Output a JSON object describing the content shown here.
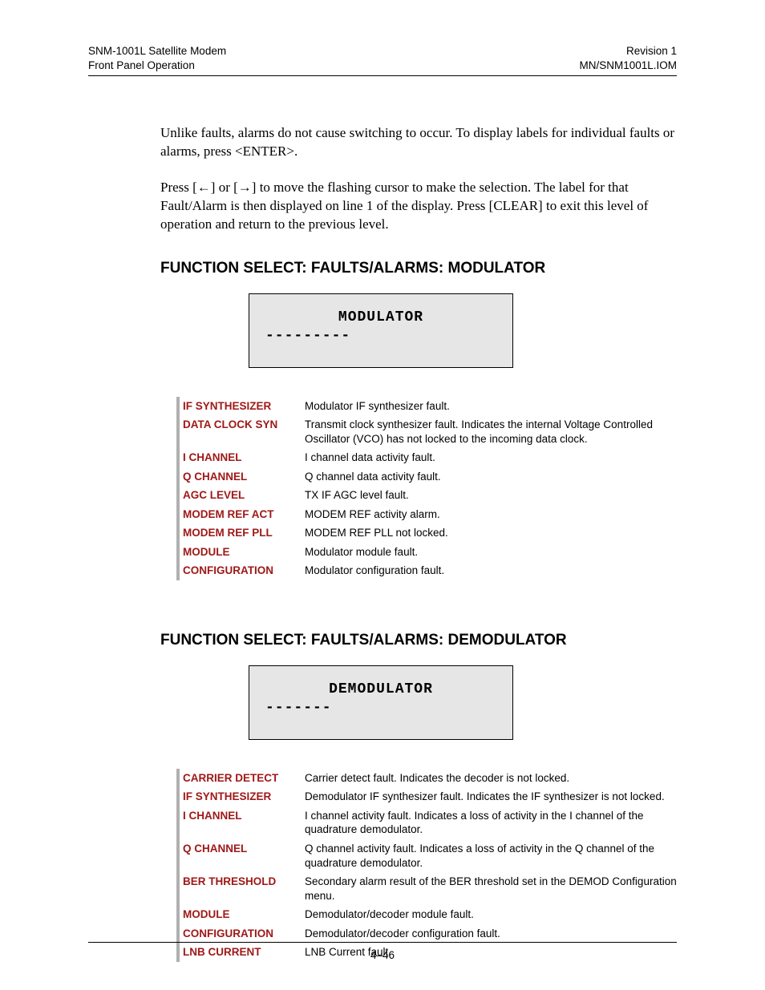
{
  "header": {
    "left1": "SNM-1001L Satellite Modem",
    "left2": "Front Panel Operation",
    "right1": "Revision 1",
    "right2": "MN/SNM1001L.IOM"
  },
  "intro": {
    "p1": "Unlike faults, alarms do not cause switching to occur. To display labels for individual faults or alarms, press <ENTER>.",
    "p2": "Press [←] or [→] to move the flashing cursor to make the selection. The label for that Fault/Alarm is then displayed on line 1 of the display. Press [CLEAR] to exit this level of operation and return to the previous level."
  },
  "sections": [
    {
      "heading": "FUNCTION SELECT: FAULTS/ALARMS: MODULATOR",
      "display": {
        "line1": "MODULATOR",
        "line2": "---------"
      },
      "rows": [
        {
          "name": "IF SYNTHESIZER",
          "desc": "Modulator IF synthesizer fault."
        },
        {
          "name": "DATA CLOCK SYN",
          "desc": "Transmit clock synthesizer fault. Indicates the internal Voltage Controlled Oscillator (VCO) has not locked to the incoming data clock."
        },
        {
          "name": "I CHANNEL",
          "desc": "I channel data activity fault."
        },
        {
          "name": "Q CHANNEL",
          "desc": "Q channel data activity fault."
        },
        {
          "name": "AGC LEVEL",
          "desc": "TX IF AGC level fault."
        },
        {
          "name": "MODEM REF ACT",
          "desc": "MODEM REF activity alarm."
        },
        {
          "name": "MODEM REF PLL",
          "desc": "MODEM REF PLL not locked."
        },
        {
          "name": "MODULE",
          "desc": "Modulator module fault."
        },
        {
          "name": "CONFIGURATION",
          "desc": "Modulator configuration fault."
        }
      ]
    },
    {
      "heading": "FUNCTION SELECT: FAULTS/ALARMS: DEMODULATOR",
      "display": {
        "line1": "DEMODULATOR",
        "line2": "-------"
      },
      "rows": [
        {
          "name": "CARRIER DETECT",
          "desc": "Carrier detect fault. Indicates the decoder is not locked."
        },
        {
          "name": "IF SYNTHESIZER",
          "desc": "Demodulator IF synthesizer fault. Indicates the IF synthesizer is not locked."
        },
        {
          "name": "I CHANNEL",
          "desc": "I channel activity fault. Indicates a loss of activity in the I channel of the quadrature demodulator."
        },
        {
          "name": "Q CHANNEL",
          "desc": "Q channel activity fault. Indicates a loss of activity in the Q channel of the quadrature demodulator."
        },
        {
          "name": "BER THRESHOLD",
          "desc": "Secondary alarm result of the BER threshold set in the DEMOD Configuration menu."
        },
        {
          "name": "MODULE",
          "desc": "Demodulator/decoder module fault."
        },
        {
          "name": "CONFIGURATION",
          "desc": "Demodulator/decoder configuration fault."
        },
        {
          "name": "LNB CURRENT",
          "desc": "LNB Current fault."
        }
      ]
    }
  ],
  "footer": {
    "page": "4–46"
  }
}
